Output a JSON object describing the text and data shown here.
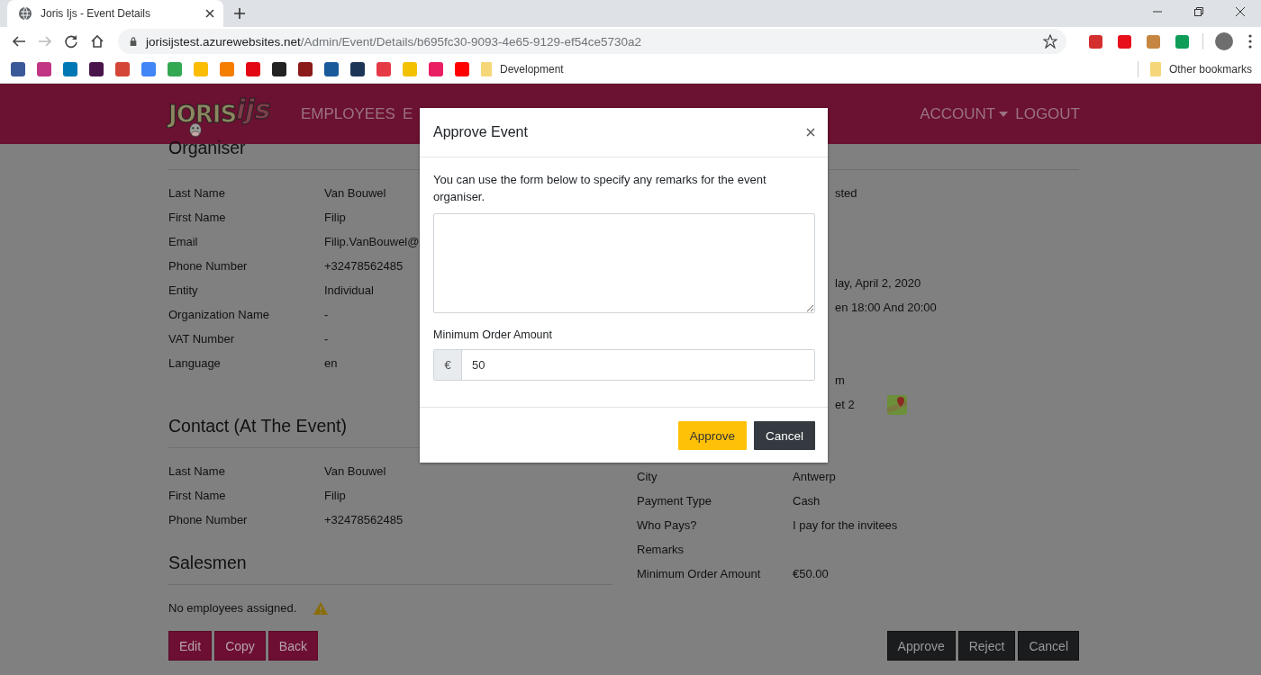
{
  "browser": {
    "tab": {
      "title": "Joris Ijs - Event Details"
    },
    "back": {
      "disabled": false
    },
    "forward": {
      "disabled": true
    },
    "address": {
      "host": "jorisijstest.azurewebsites.net",
      "path": "/Admin/Event/Details/b695fc30-9093-4e65-9129-ef54ce5730a2"
    },
    "extensions": [
      {
        "color": "#d32f2f"
      },
      {
        "color": "#e8101a"
      },
      {
        "color": "#c68642"
      },
      {
        "color": "#0f9d58"
      }
    ],
    "bookmarks": [
      {
        "color": "#3b5998"
      },
      {
        "color": "#c13584"
      },
      {
        "color": "#0077b5"
      },
      {
        "color": "#4a154b"
      },
      {
        "color": "#d44638"
      },
      {
        "color": "#4285f4"
      },
      {
        "color": "#34a853"
      },
      {
        "color": "#fbbc04"
      },
      {
        "color": "#f57d00"
      },
      {
        "color": "#e30613"
      },
      {
        "color": "#222222"
      },
      {
        "color": "#8b1a1a"
      },
      {
        "color": "#1a5a9a"
      },
      {
        "color": "#1d3557"
      },
      {
        "color": "#e63946"
      },
      {
        "color": "#f2c200"
      },
      {
        "color": "#e91e63"
      },
      {
        "color": "#ff0000"
      }
    ],
    "bookmark_folder": "Development",
    "other_bookmarks": "Other bookmarks"
  },
  "site": {
    "logo": {
      "word": "JORIS",
      "suffix": "ijs"
    },
    "nav": [
      {
        "label": "EMPLOYEES"
      },
      {
        "label": "E"
      }
    ],
    "account": "ACCOUNT",
    "logout": "LOGOUT"
  },
  "organiser": {
    "title": "Organiser",
    "rows": [
      {
        "label": "Last Name",
        "value": "Van Bouwel"
      },
      {
        "label": "First Name",
        "value": "Filip"
      },
      {
        "label": "Email",
        "value": "Filip.VanBouwel@"
      },
      {
        "label": "Phone Number",
        "value": "+32478562485"
      },
      {
        "label": "Entity",
        "value": "Individual"
      },
      {
        "label": "Organization Name",
        "value": "-"
      },
      {
        "label": "VAT Number",
        "value": "-"
      },
      {
        "label": "Language",
        "value": "en"
      }
    ]
  },
  "contact": {
    "title": "Contact (At The Event)",
    "rows": [
      {
        "label": "Last Name",
        "value": "Van Bouwel"
      },
      {
        "label": "First Name",
        "value": "Filip"
      },
      {
        "label": "Phone Number",
        "value": "+32478562485"
      }
    ]
  },
  "salesmen": {
    "title": "Salesmen",
    "empty_text": "No employees assigned."
  },
  "left_buttons": [
    "Edit",
    "Copy",
    "Back"
  ],
  "event": {
    "rows": [
      {
        "value": "sted"
      },
      {
        "value": "lay, April 2, 2020"
      },
      {
        "value": "en 18:00 And 20:00"
      },
      {
        "value": "m"
      },
      {
        "value": "et 2",
        "map": true
      },
      {
        "label": "City",
        "value": "Antwerp"
      },
      {
        "label": "Payment Type",
        "value": "Cash"
      },
      {
        "label": "Who Pays?",
        "value": "I pay for the invitees"
      },
      {
        "label": "Remarks"
      },
      {
        "label": "Minimum Order Amount",
        "value": "€50.00"
      }
    ]
  },
  "right_buttons": [
    "Approve",
    "Reject",
    "Cancel"
  ],
  "modal": {
    "title": "Approve Event",
    "text": "You can use the form below to specify any remarks for the event organiser.",
    "amount_label": "Minimum Order Amount",
    "amount_prefix": "€",
    "amount_value": "50",
    "buttons": [
      {
        "label": "Approve",
        "kind": "primary"
      },
      {
        "label": "Cancel",
        "kind": "secondary"
      }
    ]
  }
}
